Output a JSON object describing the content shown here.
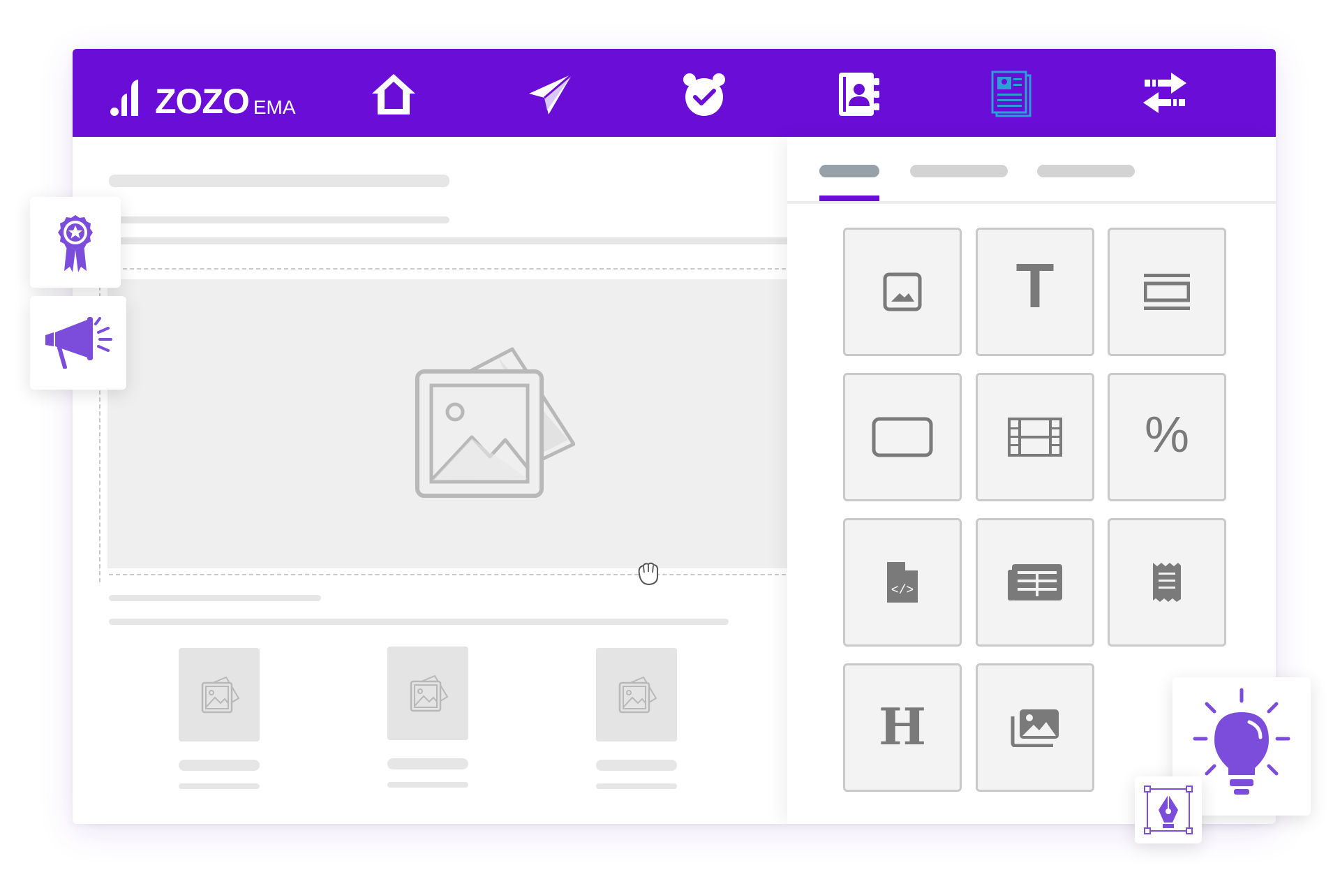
{
  "brand": {
    "name": "ZOZO",
    "sub": "EMA",
    "accent": "#6a0dd6",
    "icon_accent": "#7c4ddb"
  },
  "nav": {
    "items": [
      {
        "icon": "home-icon"
      },
      {
        "icon": "paper-plane-icon"
      },
      {
        "icon": "alarm-clock-icon"
      },
      {
        "icon": "contact-book-icon"
      },
      {
        "icon": "newsletter-icon",
        "active": true
      },
      {
        "icon": "transfer-arrows-icon"
      }
    ]
  },
  "panel": {
    "active_tab": 0,
    "blocks": [
      {
        "icon": "image-icon"
      },
      {
        "icon": "text-icon",
        "glyph": "T"
      },
      {
        "icon": "divider-icon"
      },
      {
        "icon": "button-icon"
      },
      {
        "icon": "video-icon"
      },
      {
        "icon": "percent-icon",
        "glyph": "%"
      },
      {
        "icon": "html-code-icon",
        "glyph": "</>"
      },
      {
        "icon": "table-icon"
      },
      {
        "icon": "receipt-icon"
      },
      {
        "icon": "heading-icon",
        "glyph": "H"
      },
      {
        "icon": "gallery-icon"
      }
    ]
  },
  "floating": [
    "award-badge-icon",
    "megaphone-icon",
    "lightbulb-icon",
    "pen-tool-icon"
  ]
}
